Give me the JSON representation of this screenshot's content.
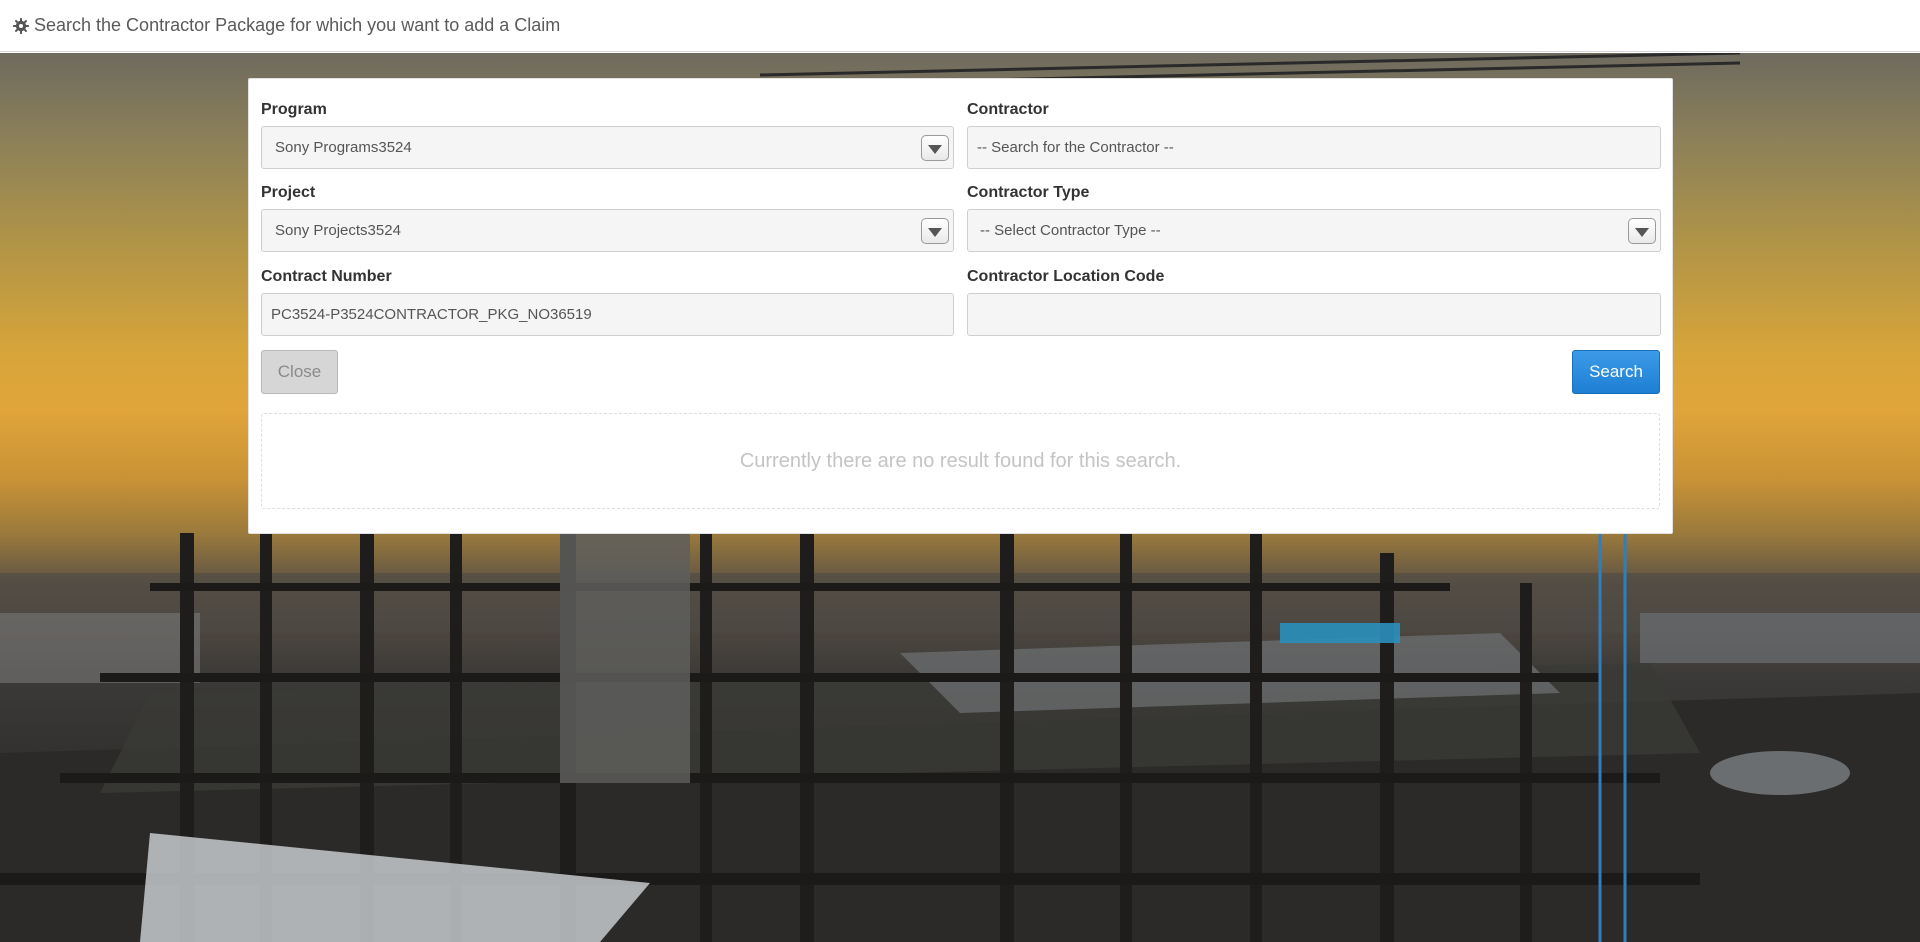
{
  "header": {
    "title": "Search the Contractor Package for which you want to add a Claim",
    "icon": "gear-icon"
  },
  "form": {
    "program": {
      "label": "Program",
      "value": "Sony Programs3524"
    },
    "contractor": {
      "label": "Contractor",
      "placeholder": "-- Search for the Contractor --"
    },
    "project": {
      "label": "Project",
      "value": "Sony Projects3524"
    },
    "contractor_type": {
      "label": "Contractor Type",
      "value": "-- Select Contractor Type --"
    },
    "contract_number": {
      "label": "Contract Number",
      "value": "PC3524-P3524CONTRACTOR_PKG_NO36519"
    },
    "contractor_location_code": {
      "label": "Contractor Location Code",
      "value": ""
    }
  },
  "buttons": {
    "close_label": "Close",
    "search_label": "Search"
  },
  "results": {
    "empty_message": "Currently there are no result found for this search."
  },
  "colors": {
    "primary_button": "#2589dc",
    "disabled_button": "#d6d6d6"
  }
}
